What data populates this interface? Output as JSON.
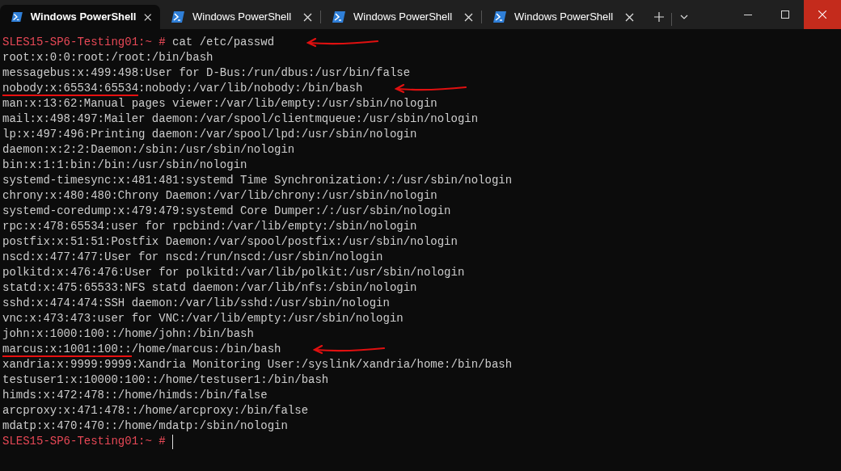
{
  "tabs": [
    {
      "title": "Windows PowerShell",
      "selected": true
    },
    {
      "title": "Windows PowerShell",
      "selected": false
    },
    {
      "title": "Windows PowerShell",
      "selected": false
    },
    {
      "title": "Windows PowerShell",
      "selected": false
    }
  ],
  "window_controls": {
    "close_highlighted": true
  },
  "terminal": {
    "lines": [
      {
        "kind": "prompt",
        "prompt": "SLES15-SP6-Testing01:~ #",
        "text": "cat /etc/passwd",
        "arrow": true
      },
      {
        "kind": "output",
        "text": "root:x:0:0:root:/root:/bin/bash"
      },
      {
        "kind": "output",
        "text": "messagebus:x:499:498:User for D-Bus:/run/dbus:/usr/bin/false"
      },
      {
        "kind": "output",
        "underlined": "nobody:x:65534:65534",
        "text": ":nobody:/var/lib/nobody:/bin/bash",
        "arrow": true
      },
      {
        "kind": "output",
        "text": "man:x:13:62:Manual pages viewer:/var/lib/empty:/usr/sbin/nologin"
      },
      {
        "kind": "output",
        "text": "mail:x:498:497:Mailer daemon:/var/spool/clientmqueue:/usr/sbin/nologin"
      },
      {
        "kind": "output",
        "text": "lp:x:497:496:Printing daemon:/var/spool/lpd:/usr/sbin/nologin"
      },
      {
        "kind": "output",
        "text": "daemon:x:2:2:Daemon:/sbin:/usr/sbin/nologin"
      },
      {
        "kind": "output",
        "text": "bin:x:1:1:bin:/bin:/usr/sbin/nologin"
      },
      {
        "kind": "output",
        "text": "systemd-timesync:x:481:481:systemd Time Synchronization:/:/usr/sbin/nologin"
      },
      {
        "kind": "output",
        "text": "chrony:x:480:480:Chrony Daemon:/var/lib/chrony:/usr/sbin/nologin"
      },
      {
        "kind": "output",
        "text": "systemd-coredump:x:479:479:systemd Core Dumper:/:/usr/sbin/nologin"
      },
      {
        "kind": "output",
        "text": "rpc:x:478:65534:user for rpcbind:/var/lib/empty:/sbin/nologin"
      },
      {
        "kind": "output",
        "text": "postfix:x:51:51:Postfix Daemon:/var/spool/postfix:/usr/sbin/nologin"
      },
      {
        "kind": "output",
        "text": "nscd:x:477:477:User for nscd:/run/nscd:/usr/sbin/nologin"
      },
      {
        "kind": "output",
        "text": "polkitd:x:476:476:User for polkitd:/var/lib/polkit:/usr/sbin/nologin"
      },
      {
        "kind": "output",
        "text": "statd:x:475:65533:NFS statd daemon:/var/lib/nfs:/sbin/nologin"
      },
      {
        "kind": "output",
        "text": "sshd:x:474:474:SSH daemon:/var/lib/sshd:/usr/sbin/nologin"
      },
      {
        "kind": "output",
        "text": "vnc:x:473:473:user for VNC:/var/lib/empty:/usr/sbin/nologin"
      },
      {
        "kind": "output",
        "text": "john:x:1000:100::/home/john:/bin/bash"
      },
      {
        "kind": "output",
        "underlined": "marcus:x:1001:100::",
        "text": "/home/marcus:/bin/bash",
        "arrow": true
      },
      {
        "kind": "output",
        "text": "xandria:x:9999:9999:Xandria Monitoring User:/syslink/xandria/home:/bin/bash"
      },
      {
        "kind": "output",
        "text": "testuser1:x:10000:100::/home/testuser1:/bin/bash"
      },
      {
        "kind": "output",
        "text": "himds:x:472:478::/home/himds:/bin/false"
      },
      {
        "kind": "output",
        "text": "arcproxy:x:471:478::/home/arcproxy:/bin/false"
      },
      {
        "kind": "output",
        "text": "mdatp:x:470:470::/home/mdatp:/sbin/nologin"
      },
      {
        "kind": "prompt",
        "prompt": "SLES15-SP6-Testing01:~ #",
        "cursor": true
      }
    ]
  }
}
